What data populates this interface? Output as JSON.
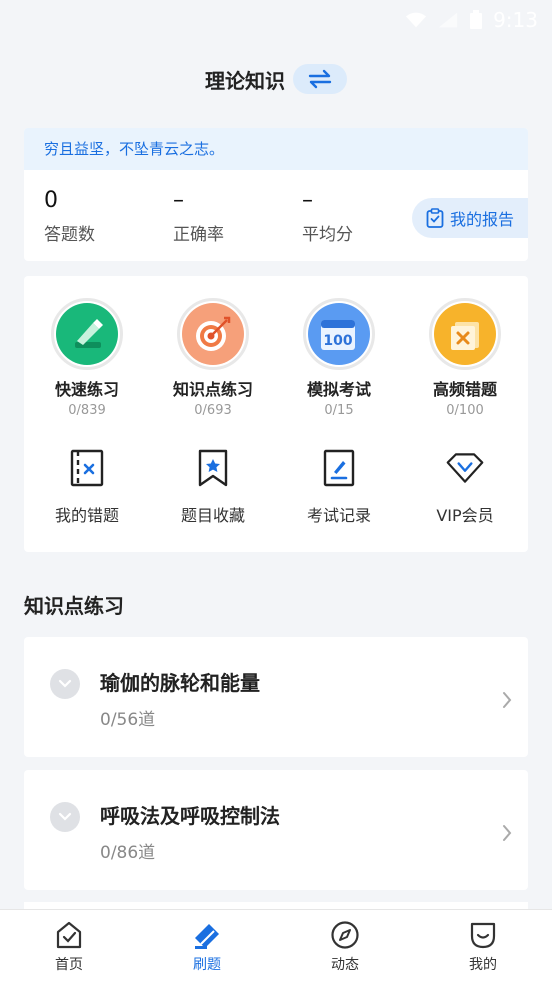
{
  "status_bar": {
    "time": "9:13"
  },
  "header": {
    "title": "理论知识"
  },
  "stats": {
    "motto": "穷且益坚，不坠青云之志。",
    "answered_value": "0",
    "answered_label": "答题数",
    "accuracy_value": "–",
    "accuracy_label": "正确率",
    "average_value": "–",
    "average_label": "平均分",
    "report_label": "我的报告"
  },
  "practice": {
    "main": [
      {
        "name": "快速练习",
        "count": "0/839"
      },
      {
        "name": "知识点练习",
        "count": "0/693"
      },
      {
        "name": "模拟考试",
        "count": "0/15"
      },
      {
        "name": "高频错题",
        "count": "0/100"
      }
    ],
    "tools": [
      {
        "name": "我的错题"
      },
      {
        "name": "题目收藏"
      },
      {
        "name": "考试记录"
      },
      {
        "name": "VIP会员"
      }
    ],
    "exam_badge": "100"
  },
  "section": {
    "title": "知识点练习"
  },
  "topics": [
    {
      "name": "瑜伽的脉轮和能量",
      "count": "0/56道"
    },
    {
      "name": "呼吸法及呼吸控制法",
      "count": "0/86道"
    }
  ],
  "nav": [
    {
      "label": "首页"
    },
    {
      "label": "刷题"
    },
    {
      "label": "动态"
    },
    {
      "label": "我的"
    }
  ],
  "colors": {
    "accent": "#1a6fe0",
    "background": "#f3f5f8"
  }
}
